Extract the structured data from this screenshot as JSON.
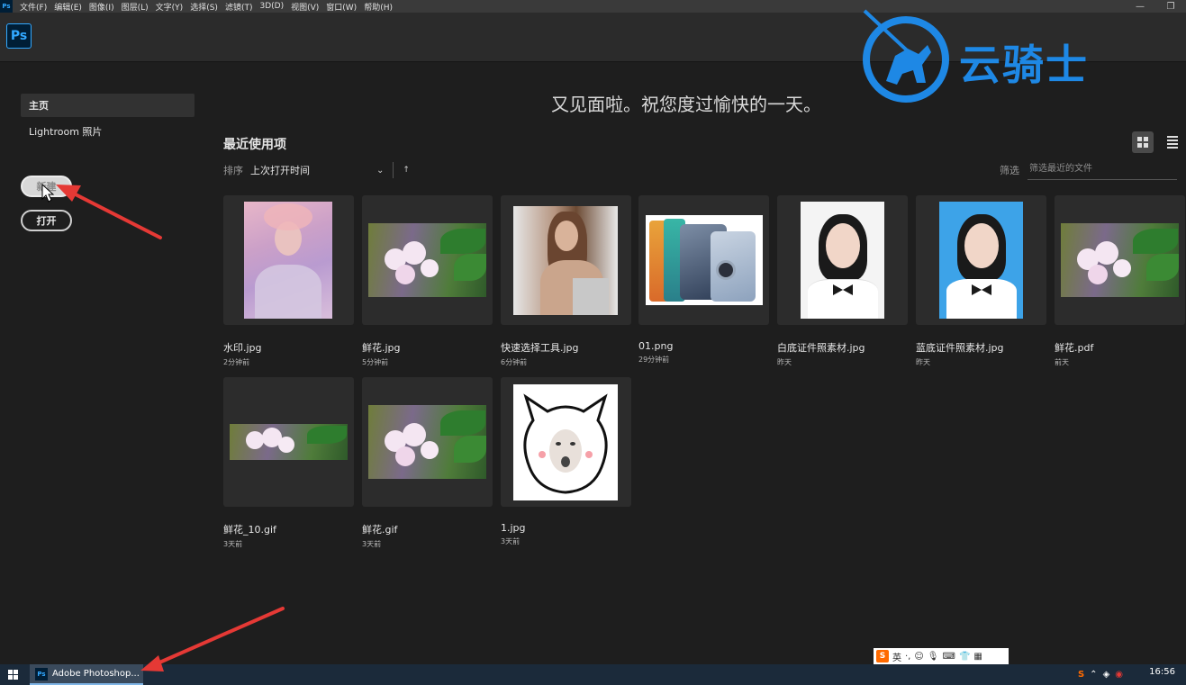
{
  "menubar": {
    "items": [
      "文件(F)",
      "编辑(E)",
      "图像(I)",
      "图层(L)",
      "文字(Y)",
      "选择(S)",
      "滤镜(T)",
      "3D(D)",
      "视图(V)",
      "窗口(W)",
      "帮助(H)"
    ],
    "app_icon": "Ps"
  },
  "header": {
    "logo": "Ps"
  },
  "sidebar": {
    "items": [
      {
        "label": "主页",
        "active": true
      },
      {
        "label": "Lightroom 照片",
        "active": false
      }
    ],
    "new_button": "新建",
    "open_button": "打开"
  },
  "main": {
    "greeting": "又见面啦。祝您度过愉快的一天。",
    "section_title": "最近使用项",
    "sort": {
      "label": "排序",
      "value": "上次打开时间",
      "direction": "↑"
    },
    "filter": {
      "label": "筛选",
      "placeholder": "筛选最近的文件"
    },
    "view_modes": [
      "grid",
      "list"
    ],
    "active_view": "grid",
    "files": [
      {
        "name": "水印.jpg",
        "time": "2分钟前",
        "art": "portrait-pink"
      },
      {
        "name": "鲜花.jpg",
        "time": "5分钟前",
        "art": "flower"
      },
      {
        "name": "快速选择工具.jpg",
        "time": "6分钟前",
        "art": "woman"
      },
      {
        "name": "01.png",
        "time": "29分钟前",
        "art": "phone"
      },
      {
        "name": "白底证件照素材.jpg",
        "time": "昨天",
        "art": "id-white"
      },
      {
        "name": "蓝底证件照素材.jpg",
        "time": "昨天",
        "art": "id-blue"
      },
      {
        "name": "鲜花.pdf",
        "time": "前天",
        "art": "flower"
      },
      {
        "name": "鲜花_10.gif",
        "time": "3天前",
        "art": "flower-wide"
      },
      {
        "name": "鲜花.gif",
        "time": "3天前",
        "art": "flower"
      },
      {
        "name": "1.jpg",
        "time": "3天前",
        "art": "meme"
      }
    ]
  },
  "watermark": {
    "text": "云骑士"
  },
  "taskbar": {
    "app_label": "Adobe Photoshop...",
    "app_icon": "Ps",
    "time": "16:56"
  },
  "ime": {
    "lang": "英"
  },
  "colors": {
    "accent": "#31a8ff",
    "background": "#1e1e1e",
    "annotation_arrow": "#e53935",
    "watermark": "#1e88e5"
  }
}
